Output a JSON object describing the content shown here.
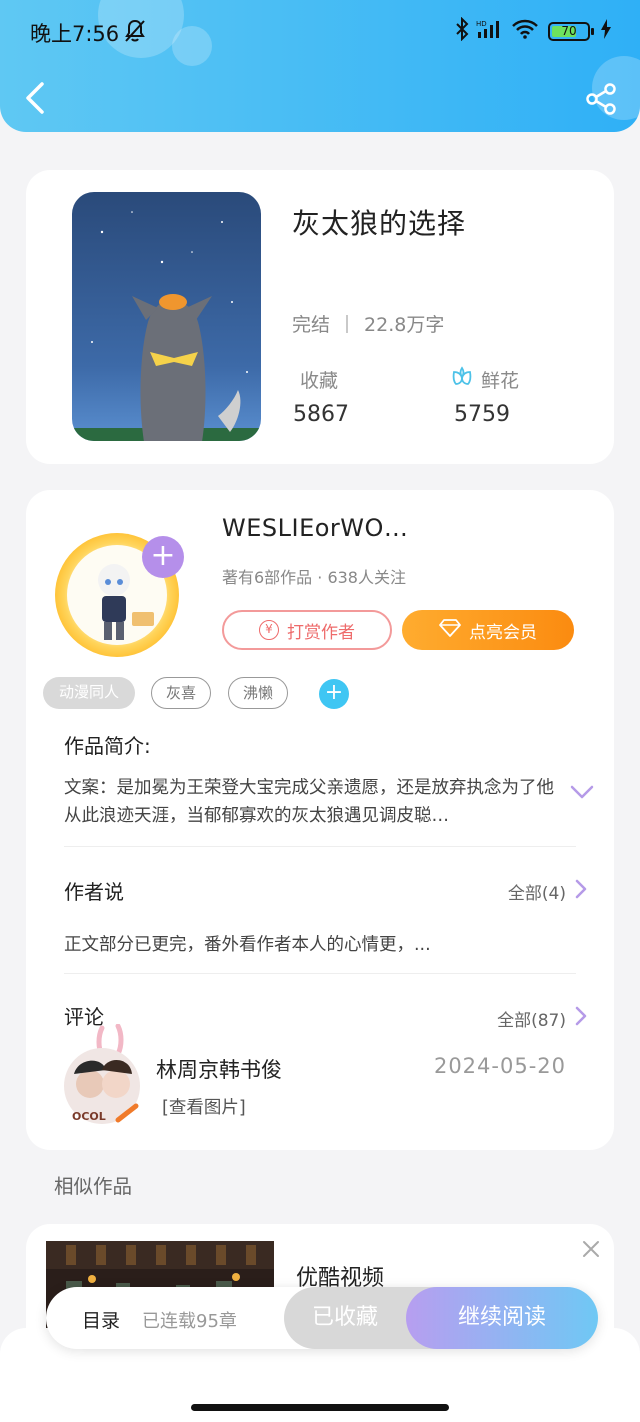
{
  "status_bar": {
    "time": "晚上7:56",
    "battery": "70",
    "battery_level": 0.7
  },
  "colors": {
    "header_gradient": [
      "#5fc8f3",
      "#2fb0f6"
    ],
    "vip": "#fb8b10",
    "tip": "#ee6b6b",
    "read_gradient": [
      "#b79ef0",
      "#6fc8f4"
    ]
  },
  "icons": {
    "back": "back-arrow-icon",
    "share": "share-icon",
    "flower": "flower-icon",
    "close": "close-icon"
  },
  "book": {
    "title": "灰太狼的选择",
    "status": "完结",
    "word_count": "22.8万字",
    "favorites_label": "收藏",
    "favorites_count": "5867",
    "flowers_label": "鲜花",
    "flowers_count": "5759"
  },
  "author": {
    "name": "WESLIEorWO…",
    "stats": "著有6部作品 · 638人关注",
    "tip_label": "打赏作者",
    "tip_coin": "¥",
    "vip_label": "点亮会员",
    "follow_plus": "+"
  },
  "tags": [
    "动漫同人",
    "灰喜",
    "沸懒"
  ],
  "tag_add": "+",
  "intro": {
    "heading": "作品简介:",
    "text": "文案：是加冕为王荣登大宝完成父亲遗愿，还是放弃执念为了他从此浪迹天涯，当郁郁寡欢的灰太狼遇见调皮聪…"
  },
  "author_says": {
    "heading": "作者说",
    "more": "全部(4)",
    "text": "正文部分已更完，番外看作者本人的心情更，..."
  },
  "comments": {
    "heading": "评论",
    "more": "全部(87)",
    "item": {
      "user": "林周京韩书俊",
      "date": "2024-05-20",
      "text": "[查看图片]"
    }
  },
  "similar": {
    "heading": "相似作品",
    "item_title": "优酷视频"
  },
  "bottom_bar": {
    "toc": "目录",
    "serial": "已连载95章",
    "fav": "已收藏",
    "read": "继续阅读"
  }
}
